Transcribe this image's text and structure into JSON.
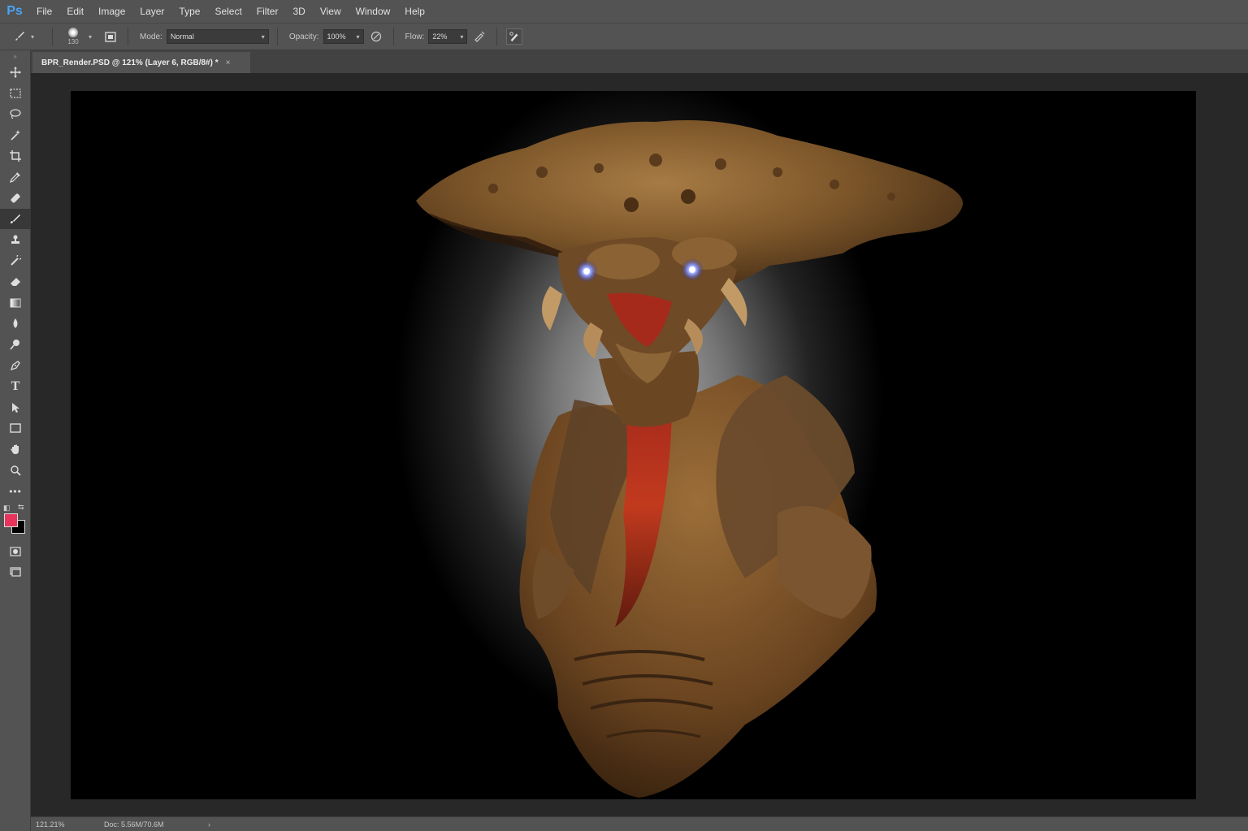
{
  "app": {
    "logo": "Ps"
  },
  "menu": [
    "File",
    "Edit",
    "Image",
    "Layer",
    "Type",
    "Select",
    "Filter",
    "3D",
    "View",
    "Window",
    "Help"
  ],
  "options": {
    "tool_icon": "brush-icon",
    "brush_size": "130",
    "mode_label": "Mode:",
    "mode_value": "Normal",
    "opacity_label": "Opacity:",
    "opacity_value": "100%",
    "flow_label": "Flow:",
    "flow_value": "22%"
  },
  "tools": [
    "move-icon",
    "marquee-icon",
    "lasso-icon",
    "magic-wand-icon",
    "crop-icon",
    "eyedropper-icon",
    "healing-brush-icon",
    "brush-icon",
    "clone-stamp-icon",
    "history-brush-icon",
    "eraser-icon",
    "gradient-icon",
    "blur-icon",
    "dodge-icon",
    "pen-icon",
    "type-icon",
    "path-selection-icon",
    "rectangle-icon",
    "hand-icon",
    "zoom-icon",
    "more-tools-icon"
  ],
  "colors": {
    "foreground": "#e8345a",
    "background": "#000000",
    "accent": "#4aa3f5"
  },
  "document": {
    "tab_title": "BPR_Render.PSD @ 121% (Layer 6, RGB/8#) *",
    "close_glyph": "×"
  },
  "status": {
    "zoom": "121.21%",
    "doc_size": "Doc: 5.56M/70.6M",
    "arrow": "›"
  }
}
